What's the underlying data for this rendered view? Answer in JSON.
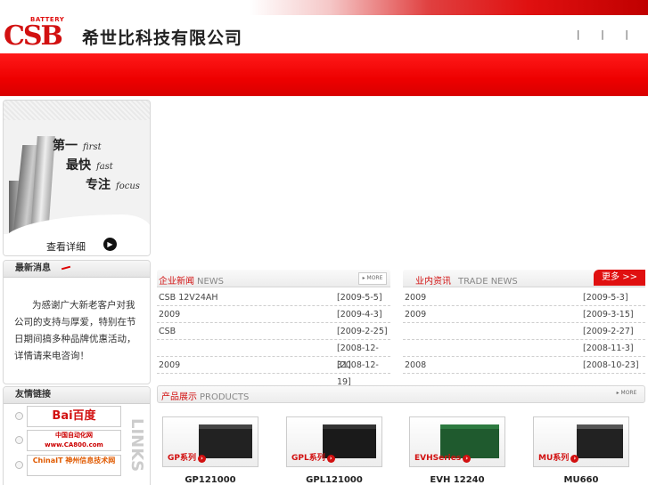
{
  "brand": {
    "logo_small": "BATTERY",
    "logo_main": "CSB",
    "company": "希世比科技有限公司",
    "toplinks": "| | |"
  },
  "colors": {
    "accent": "#d21010",
    "redbar": "#ee0000"
  },
  "banner": {
    "line1": "第一",
    "line1_en": "first",
    "line2": "最快",
    "line2_en": "fast",
    "line3": "专注",
    "line3_en": "focus",
    "detail": "查看详细"
  },
  "notice": {
    "title": "最新消息",
    "text": "为感谢广大新老客户对我公司的支持与厚爱，特别在节日期间搞多种品牌优惠活动，详情请来电咨询！"
  },
  "links": {
    "title": "友情链接",
    "items": [
      "Bai百度",
      "中国自动化网 www.CA800.com",
      "ChinaIT 神州信息技术网"
    ],
    "vertical": "LINKS"
  },
  "company_news": {
    "title": "企业新闻",
    "title_en": "NEWS",
    "more": "MORE",
    "rows": [
      {
        "title": "CSB 12V24AH",
        "date": "[2009-5-5]"
      },
      {
        "title": "2009",
        "date": "[2009-4-3]"
      },
      {
        "title": "CSB",
        "date": "[2009-2-25]"
      },
      {
        "title": "",
        "date": "[2008-12-31]"
      },
      {
        "title": "2009",
        "date": "[2008-12-19]"
      }
    ]
  },
  "industry_news": {
    "title": "业内资讯",
    "title_en": "TRADE NEWS",
    "more": "更多 >>",
    "rows": [
      {
        "title": "2009",
        "date": "[2009-5-3]"
      },
      {
        "title": "2009",
        "date": "[2009-3-15]"
      },
      {
        "title": "",
        "date": "[2009-2-27]"
      },
      {
        "title": "",
        "date": "[2008-11-3]"
      },
      {
        "title": "2008",
        "date": "[2008-10-23]"
      }
    ]
  },
  "products": {
    "title": "产品展示",
    "title_en": "PRODUCTS",
    "more": "MORE",
    "items": [
      {
        "label": "GP系列",
        "name": "GP121000",
        "color": "#222"
      },
      {
        "label": "GPL系列",
        "name": "GPL121000",
        "color": "#1a1a1a"
      },
      {
        "label": "EVHSeries",
        "name": "EVH 12240",
        "color": "#1f5a2e"
      },
      {
        "label": "MU系列",
        "name": "MU660",
        "color": "#222"
      }
    ]
  }
}
